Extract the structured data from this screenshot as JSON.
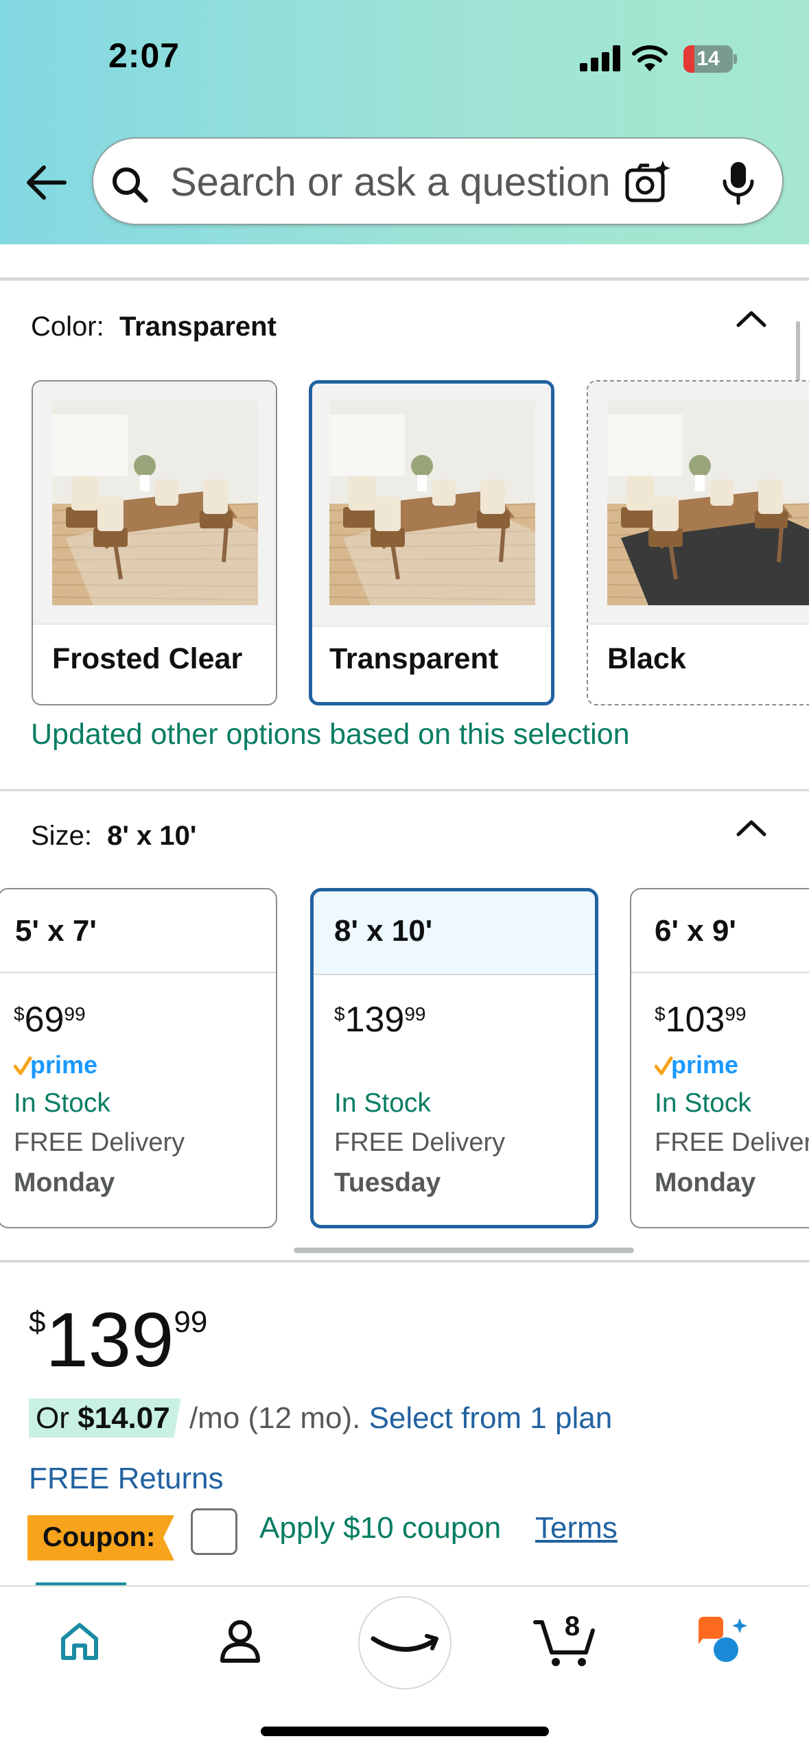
{
  "status_bar": {
    "time": "2:07",
    "battery": "14"
  },
  "search": {
    "placeholder": "Search or ask a question"
  },
  "color_section": {
    "label": "Color:",
    "value": "Transparent",
    "options": [
      {
        "name": "Frosted Clear",
        "floor": "#c8a273",
        "selected": false,
        "available": true
      },
      {
        "name": "Transparent",
        "floor": "#c9a475",
        "selected": true,
        "available": true
      },
      {
        "name": "Black",
        "floor": "#3a3a3a",
        "selected": false,
        "available": false
      }
    ],
    "notice": "Updated other options based on this selection"
  },
  "size_section": {
    "label": "Size:",
    "value": "8' x 10'",
    "options": [
      {
        "size": "5' x 7'",
        "price_whole": "69",
        "price_cents": "99",
        "prime": true,
        "stock": "In Stock",
        "delivery": "FREE Delivery",
        "day": "Monday",
        "selected": false
      },
      {
        "size": "8' x 10'",
        "price_whole": "139",
        "price_cents": "99",
        "prime": false,
        "stock": "In Stock",
        "delivery": "FREE Delivery",
        "day": "Tuesday",
        "selected": true
      },
      {
        "size": "6' x 9'",
        "price_whole": "103",
        "price_cents": "99",
        "prime": true,
        "stock": "In Stock",
        "delivery": "FREE Delivery",
        "day": "Monday",
        "selected": false
      }
    ]
  },
  "price": {
    "currency": "$",
    "whole": "139",
    "cents": "99"
  },
  "installments": {
    "prefix": "Or",
    "amount": "$14.07",
    "suffix": "/mo (12 mo).",
    "link": "Select from 1 plan"
  },
  "free_returns": "FREE Returns",
  "coupon": {
    "badge": "Coupon:",
    "apply": "Apply $10 coupon",
    "terms": "Terms"
  },
  "prime_text": "prime",
  "tabbar": {
    "cart_count": "8",
    "items": [
      "home-icon",
      "account-icon",
      "amazon-smile-icon",
      "cart-icon",
      "rufus-icon"
    ]
  },
  "colors": {
    "link": "#2162a1",
    "success": "#067d62",
    "selected_border": "#2162a1",
    "prime_blue": "#1a98ff",
    "coupon": "#f7a31c"
  }
}
